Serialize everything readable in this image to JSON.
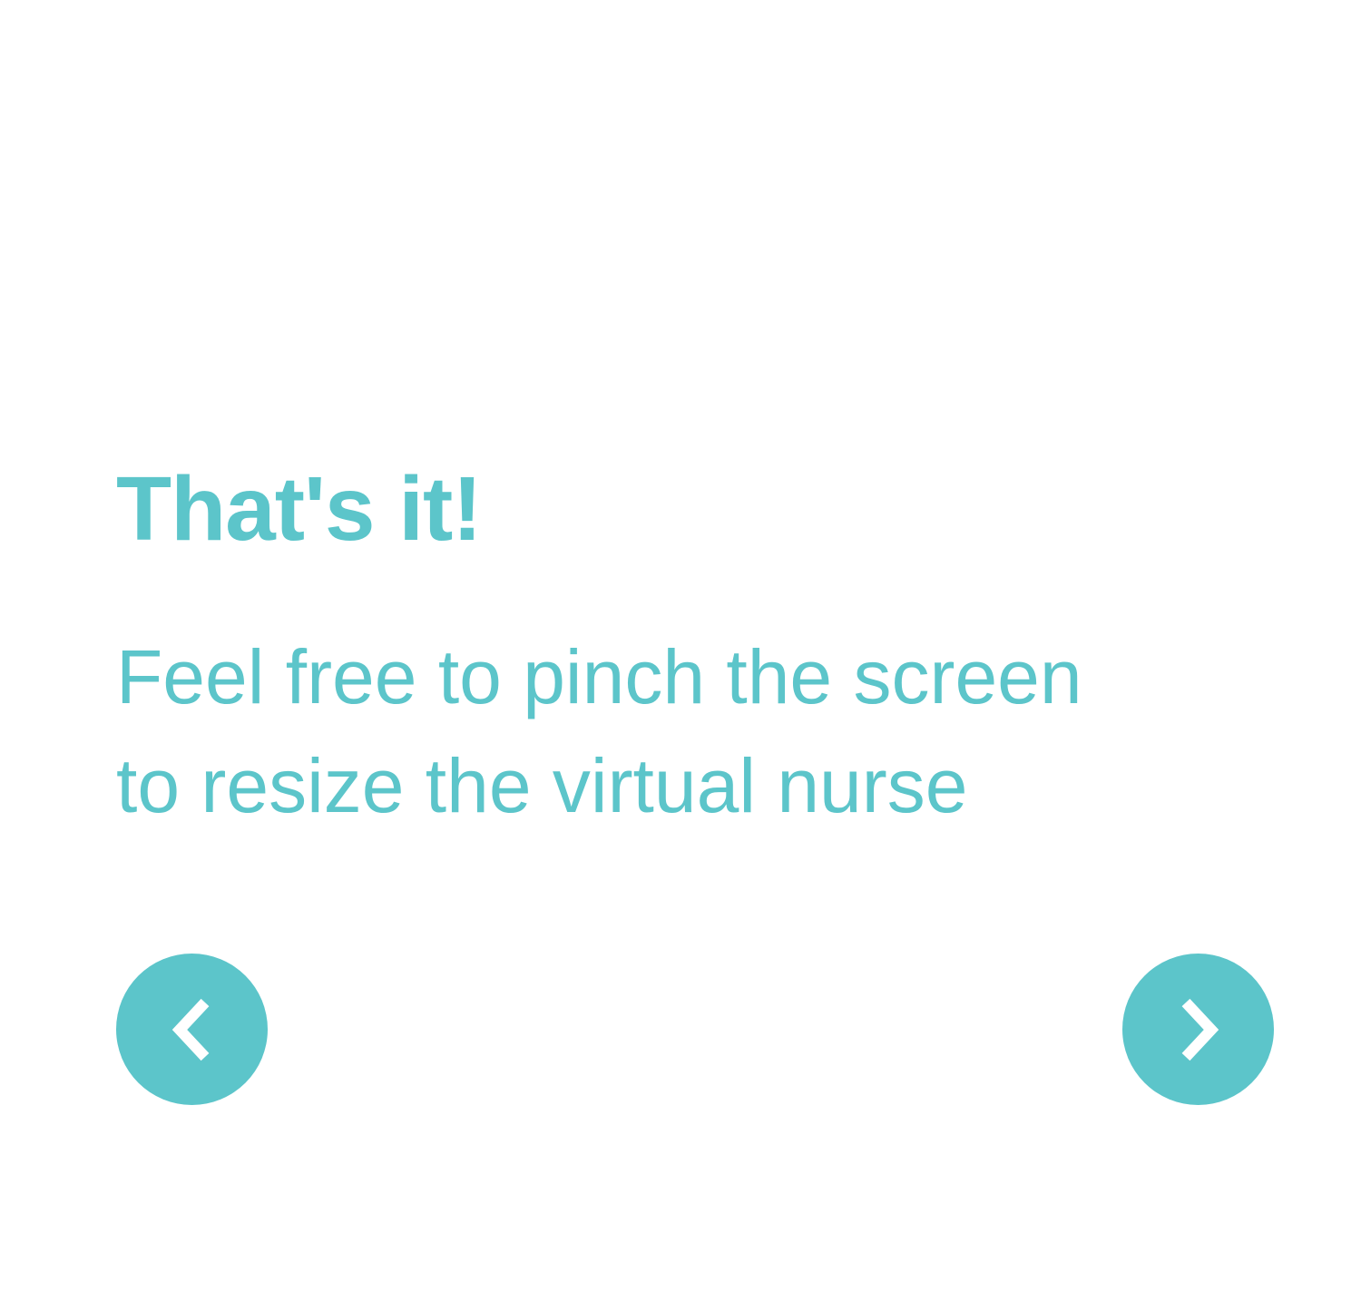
{
  "screen": {
    "title": "That's it!",
    "body_lines": [
      "Feel free to pinch the screen",
      "to resize the virtual nurse"
    ]
  },
  "navigation": {
    "prev_icon": "chevron-left-icon",
    "next_icon": "chevron-right-icon"
  },
  "colors": {
    "accent": "#5cc5ca",
    "background": "#ffffff",
    "icon": "#ffffff"
  }
}
